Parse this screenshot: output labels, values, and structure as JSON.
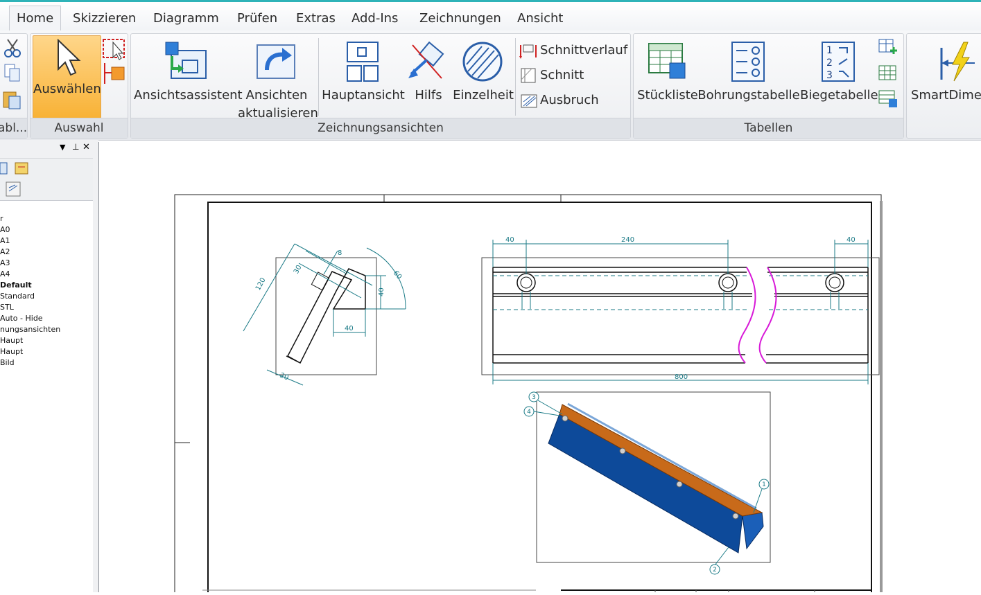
{
  "menu": {
    "tabs": [
      "Home",
      "Skizzieren",
      "Diagramm",
      "Prüfen",
      "Extras",
      "Add-Ins",
      "Zeichnungen",
      "Ansicht"
    ]
  },
  "ribbon": {
    "clipboard_group_label": "abl...",
    "select_button": "Auswählen",
    "select_group_label": "Auswahl",
    "view_wizard_button": "Ansichtsassistent",
    "update_views_button_line1": "Ansichten",
    "update_views_button_line2": "aktualisieren",
    "main_view_button": "Hauptansicht",
    "auxiliary_button": "Hilfs",
    "detail_button": "Einzelheit",
    "section_line_button": "Schnittverlauf",
    "section_button": "Schnitt",
    "breakout_button": "Ausbruch",
    "drawing_views_group_label": "Zeichnungsansichten",
    "parts_list_button": "Stückliste",
    "hole_table_button": "Bohrungstabelle",
    "bend_table_button": "Biegetabelle",
    "tables_group_label": "Tabellen",
    "smart_dimension_button": "SmartDimen"
  },
  "panel": {
    "tree_items": [
      "r",
      "A0",
      "A1",
      "A2",
      "A3",
      "A4",
      "Default",
      "Standard",
      "STL",
      "Auto - Hide",
      "nungsansichten",
      "Haupt",
      "Haupt",
      "Bild"
    ]
  },
  "drawing": {
    "dims": {
      "d40_left": "40",
      "d240": "240",
      "d40_right": "40",
      "d800": "800",
      "d120": "120",
      "d30": "30",
      "d8": "8",
      "d40_side": "40",
      "d40_bottom": "40",
      "d20": "20",
      "d60": "60"
    },
    "balloons": [
      "3",
      "4",
      "1",
      "2"
    ]
  },
  "colors": {
    "accent": "#2eb3b8",
    "select_highlight": "#f8b236",
    "dimension": "#1a7a86",
    "break_line": "#d81ad8",
    "part_blue": "#0d4a9a",
    "part_orange": "#c86a1a"
  }
}
